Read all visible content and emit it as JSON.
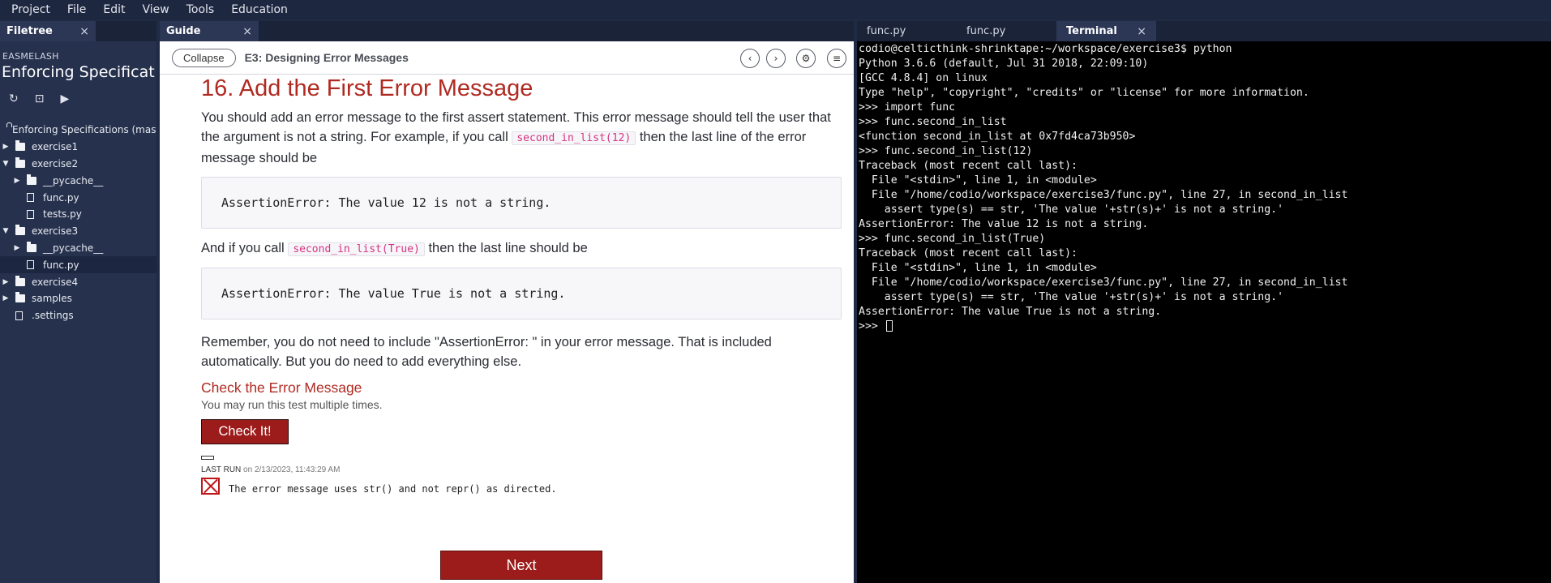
{
  "menubar": [
    "Project",
    "File",
    "Edit",
    "View",
    "Tools",
    "Education"
  ],
  "filetree": {
    "tab_label": "Filetree",
    "close_glyph": "×",
    "subtitle": "EASMELASH",
    "title": "Enforcing Specificati...",
    "tools": [
      "↻",
      "⊡",
      "▶"
    ],
    "items": [
      {
        "label": "Enforcing Specifications (maste",
        "type": "root",
        "indent": 0
      },
      {
        "label": "exercise1",
        "type": "folder",
        "arrow": "▶",
        "indent": 0
      },
      {
        "label": "exercise2",
        "type": "folder",
        "arrow": "▼",
        "indent": 0
      },
      {
        "label": "__pycache__",
        "type": "folder",
        "arrow": "▶",
        "indent": 1
      },
      {
        "label": "func.py",
        "type": "file",
        "arrow": "",
        "indent": 1
      },
      {
        "label": "tests.py",
        "type": "file",
        "arrow": "",
        "indent": 1
      },
      {
        "label": "exercise3",
        "type": "folder",
        "arrow": "▼",
        "indent": 0
      },
      {
        "label": "__pycache__",
        "type": "folder",
        "arrow": "▶",
        "indent": 1
      },
      {
        "label": "func.py",
        "type": "file",
        "arrow": "",
        "indent": 1,
        "selected": true
      },
      {
        "label": "exercise4",
        "type": "folder",
        "arrow": "▶",
        "indent": 0
      },
      {
        "label": "samples",
        "type": "folder",
        "arrow": "▶",
        "indent": 0
      },
      {
        "label": ".settings",
        "type": "file",
        "arrow": "",
        "indent": 0
      }
    ]
  },
  "guide": {
    "tab_label": "Guide",
    "close_glyph": "×",
    "collapse_label": "Collapse",
    "section_title": "E3: Designing Error Messages",
    "toolbar_icons": [
      "‹",
      "›",
      "⚙",
      "≡"
    ],
    "step_title": "16. Add the First Error Message",
    "para1_a": "You should add an error message to the first assert statement. This error message should tell the user that the argument is not a string. For example, if you call ",
    "para1_code": "second_in_list(12)",
    "para1_b": " then the last line of the error message should be",
    "code1": "AssertionError: The value 12 is not a string.",
    "para2_a": "And if you call ",
    "para2_code": "second_in_list(True)",
    "para2_b": " then the last line should be",
    "code2": "AssertionError: The value True is not a string.",
    "para3": "Remember, you do not need to include \"AssertionError: \" in your error message. That is included automatically. But you do need to add everything else.",
    "check_heading": "Check the Error Message",
    "check_note": "You may run this test multiple times.",
    "check_button": "Check It!",
    "last_run_label": "LAST RUN",
    "last_run_time": " on 2/13/2023, 11:43:29 AM",
    "result_text": "The error message uses str() and not repr() as directed.",
    "next_button": "Next"
  },
  "terminal": {
    "tabs": [
      {
        "label": "func.py",
        "active": false,
        "closable": false
      },
      {
        "label": "func.py",
        "active": false,
        "closable": false
      },
      {
        "label": "Terminal",
        "active": true,
        "closable": true
      }
    ],
    "close_glyph": "×",
    "lines": [
      "codio@celticthink-shrinktape:~/workspace/exercise3$ python",
      "Python 3.6.6 (default, Jul 31 2018, 22:09:10)",
      "[GCC 4.8.4] on linux",
      "Type \"help\", \"copyright\", \"credits\" or \"license\" for more information.",
      ">>> import func",
      ">>> func.second_in_list",
      "<function second_in_list at 0x7fd4ca73b950>",
      ">>> func.second_in_list(12)",
      "Traceback (most recent call last):",
      "  File \"<stdin>\", line 1, in <module>",
      "  File \"/home/codio/workspace/exercise3/func.py\", line 27, in second_in_list",
      "    assert type(s) == str, 'The value '+str(s)+' is not a string.'",
      "AssertionError: The value 12 is not a string.",
      ">>> func.second_in_list(True)",
      "Traceback (most recent call last):",
      "  File \"<stdin>\", line 1, in <module>",
      "  File \"/home/codio/workspace/exercise3/func.py\", line 27, in second_in_list",
      "    assert type(s) == str, 'The value '+str(s)+' is not a string.'",
      "AssertionError: The value True is not a string."
    ],
    "prompt": ">>> "
  }
}
